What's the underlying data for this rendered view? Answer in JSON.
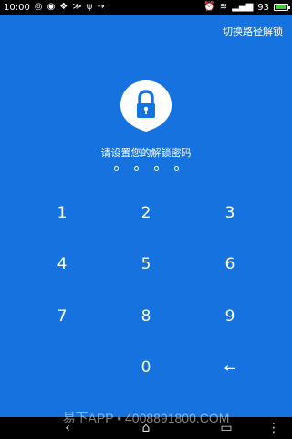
{
  "status_bar": {
    "time": "10:00",
    "battery_percent": "93",
    "battery_level": 0.93,
    "left_icons": [
      "circles-icon",
      "swirl-icon",
      "chat-icon",
      "bird-icon",
      "usb-icon",
      "usb-icon"
    ],
    "right_icons": [
      "alarm-icon",
      "wifi-icon",
      "signal-icon"
    ]
  },
  "header": {
    "switch_label": "切换路径解锁"
  },
  "lock": {
    "prompt": "请设置您的解锁密码",
    "pin_length": 4,
    "entered": 0
  },
  "keypad": {
    "k1": "1",
    "k2": "2",
    "k3": "3",
    "k4": "4",
    "k5": "5",
    "k6": "6",
    "k7": "7",
    "k8": "8",
    "k9": "9",
    "k0": "0",
    "backspace": "←"
  },
  "watermark": "易下APP • 4008891800.COM",
  "colors": {
    "background": "#1672de",
    "text": "#ffffff",
    "battery_fill": "#3ecf3e"
  }
}
